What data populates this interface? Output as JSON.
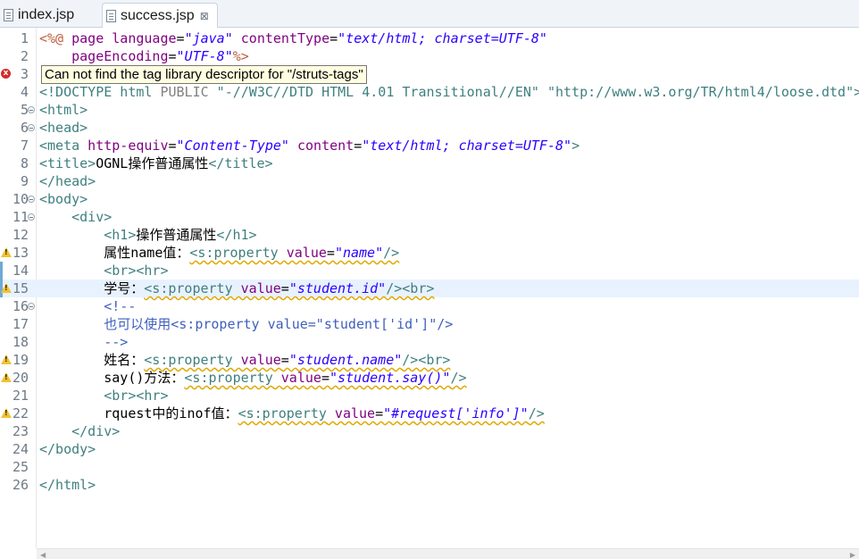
{
  "tabs": [
    {
      "label": "index.jsp",
      "active": false
    },
    {
      "label": "success.jsp",
      "active": true,
      "close_glyph": "⊠"
    }
  ],
  "tooltip": "Can not find the tag library descriptor for \"/struts-tags\"",
  "lines": [
    {
      "num": "1"
    },
    {
      "num": "2"
    },
    {
      "num": "3"
    },
    {
      "num": "4"
    },
    {
      "num": "5"
    },
    {
      "num": "6"
    },
    {
      "num": "7"
    },
    {
      "num": "8"
    },
    {
      "num": "9"
    },
    {
      "num": "10"
    },
    {
      "num": "11"
    },
    {
      "num": "12"
    },
    {
      "num": "13"
    },
    {
      "num": "14"
    },
    {
      "num": "15"
    },
    {
      "num": "16"
    },
    {
      "num": "17"
    },
    {
      "num": "18"
    },
    {
      "num": "19"
    },
    {
      "num": "20"
    },
    {
      "num": "21"
    },
    {
      "num": "22"
    },
    {
      "num": "23"
    },
    {
      "num": "24"
    },
    {
      "num": "25"
    },
    {
      "num": "26"
    }
  ],
  "code": {
    "l1": {
      "open": "<%@",
      "kw": " page ",
      "a1": "language",
      "eq1": "=",
      "v1": "\"java\"",
      "a2": " contentType",
      "eq2": "=",
      "v2": "\"text/html; charset=UTF-8\""
    },
    "l2": {
      "a": "    pageEncoding",
      "eq": "=",
      "v": "\"UTF-8\"",
      "close": "%>"
    },
    "l4": {
      "text": "<!DOCTYPE html ",
      "pub": "PUBLIC",
      "rest": " \"-//W3C//DTD HTML 4.01 Transitional//EN\" \"http://www.w3.org/TR/html4/loose.dtd\">"
    },
    "l5": "<html>",
    "l6": "<head>",
    "l7": {
      "tag": "<meta",
      "a1": " http-equiv",
      "eq1": "=",
      "v1": "\"Content-Type\"",
      "a2": " content",
      "eq2": "=",
      "v2": "\"text/html; charset=UTF-8\"",
      "end": ">"
    },
    "l8": {
      "open": "<title>",
      "text": "OGNL操作普通属性",
      "close": "</title>"
    },
    "l9": "</head>",
    "l10": "<body>",
    "l11": "    <div>",
    "l12": {
      "indent": "        ",
      "open": "<h1>",
      "text": "操作普通属性",
      "close": "</h1>"
    },
    "l13": {
      "indent": "        ",
      "text": "属性name值：",
      "tag": "<s:property",
      "a": " value",
      "eq": "=",
      "v": "\"name\"",
      "end": "/>"
    },
    "l14": "        <br><hr>",
    "l15": {
      "indent": "        ",
      "text": "学号：",
      "tag": "<s:property",
      "a": " value",
      "eq": "=",
      "v": "\"student.id\"",
      "end": "/><br>"
    },
    "l16": "        <!--",
    "l17": "        也可以使用<s:property value=\"student['id']\"/>",
    "l18": "        -->",
    "l19": {
      "indent": "        ",
      "text": "姓名：",
      "tag": "<s:property",
      "a": " value",
      "eq": "=",
      "v": "\"student.name\"",
      "end": "/><br>"
    },
    "l20": {
      "indent": "        ",
      "text": "say()方法：",
      "tag": "<s:property",
      "a": " value",
      "eq": "=",
      "v": "\"student.say()\"",
      "end": "/>"
    },
    "l21": "        <br><hr>",
    "l22": {
      "indent": "        ",
      "text": "rquest中的inof值：",
      "tag": "<s:property",
      "a": " value",
      "eq": "=",
      "v": "\"#request['info']\"",
      "end": "/>"
    },
    "l23": "    </div>",
    "l24": "</body>",
    "l25": "",
    "l26": "</html>"
  },
  "markers": {
    "error_line": "3",
    "warning_lines": [
      "13",
      "15",
      "19",
      "20",
      "22"
    ]
  },
  "colors": {
    "tag": "#3f7f7f",
    "attribute": "#7f007f",
    "string": "#2a00ff",
    "jsp_delimiter": "#bf5f3f",
    "comment": "#3f5fbf",
    "current_line": "#e8f2fe",
    "error": "#d52b2b",
    "warning": "#f2c230"
  }
}
